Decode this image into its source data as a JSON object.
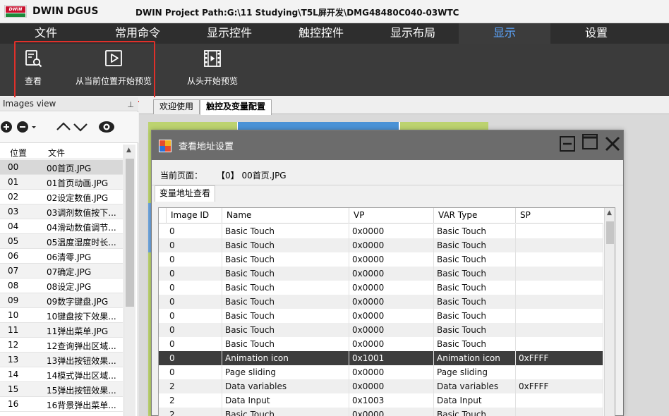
{
  "titlebar": {
    "logo_text": "DWIN",
    "app_name": "DWIN DGUS",
    "project_path": "DWIN Project Path:G:\\11 Studying\\T5L屏开发\\DMG48480C040-03WTC"
  },
  "menu": {
    "items": [
      "文件",
      "常用命令",
      "显示控件",
      "触控控件",
      "显示布局",
      "显示",
      "设置"
    ],
    "active_index": 5,
    "active_color": "#5ca6ff"
  },
  "ribbon": {
    "buttons": [
      {
        "label": "查看",
        "icon": "search-document-icon"
      },
      {
        "label": "从当前位置开始预览",
        "icon": "play-icon"
      },
      {
        "label": "从头开始预览",
        "icon": "film-play-icon"
      }
    ],
    "highlight_color": "#e0302a"
  },
  "images_view": {
    "title": "Images view",
    "toolbar_icons": [
      "add-icon",
      "remove-icon",
      "up-icon",
      "down-icon",
      "eye-icon"
    ],
    "columns": [
      "位置",
      "文件"
    ],
    "rows": [
      {
        "idx": "00",
        "file": "00首页.JPG"
      },
      {
        "idx": "01",
        "file": "01首页动画.JPG"
      },
      {
        "idx": "02",
        "file": "02设定数值.JPG"
      },
      {
        "idx": "03",
        "file": "03调剂数值按下..."
      },
      {
        "idx": "04",
        "file": "04滑动数值调节..."
      },
      {
        "idx": "05",
        "file": "05温度湿度时长..."
      },
      {
        "idx": "06",
        "file": "06清零.JPG"
      },
      {
        "idx": "07",
        "file": "07确定.JPG"
      },
      {
        "idx": "08",
        "file": "08设定.JPG"
      },
      {
        "idx": "09",
        "file": "09数字键盘.JPG"
      },
      {
        "idx": "10",
        "file": "10键盘按下效果..."
      },
      {
        "idx": "11",
        "file": "11弹出菜单.JPG"
      },
      {
        "idx": "12",
        "file": "12查询弹出区域..."
      },
      {
        "idx": "13",
        "file": "13弹出按钮效果..."
      },
      {
        "idx": "14",
        "file": "14模式弹出区域..."
      },
      {
        "idx": "15",
        "file": "15弹出按钮效果..."
      },
      {
        "idx": "16",
        "file": "16背景弹出菜单..."
      }
    ],
    "selected_index": 0
  },
  "workspace": {
    "tabs": [
      "欢迎使用",
      "触控及变量配置"
    ],
    "active_tab": 1
  },
  "dialog": {
    "title": "查看地址设置",
    "current_page_label": "当前页面：",
    "current_page_value": "【0】 00首页.JPG",
    "tab": "变量地址查看",
    "columns": [
      "Image ID",
      "Name",
      "VP",
      "VAR Type",
      "SP"
    ],
    "rows": [
      [
        "0",
        "Basic Touch",
        "0x0000",
        "Basic Touch",
        ""
      ],
      [
        "0",
        "Basic Touch",
        "0x0000",
        "Basic Touch",
        ""
      ],
      [
        "0",
        "Basic Touch",
        "0x0000",
        "Basic Touch",
        ""
      ],
      [
        "0",
        "Basic Touch",
        "0x0000",
        "Basic Touch",
        ""
      ],
      [
        "0",
        "Basic Touch",
        "0x0000",
        "Basic Touch",
        ""
      ],
      [
        "0",
        "Basic Touch",
        "0x0000",
        "Basic Touch",
        ""
      ],
      [
        "0",
        "Basic Touch",
        "0x0000",
        "Basic Touch",
        ""
      ],
      [
        "0",
        "Basic Touch",
        "0x0000",
        "Basic Touch",
        ""
      ],
      [
        "0",
        "Basic Touch",
        "0x0000",
        "Basic Touch",
        ""
      ],
      [
        "0",
        "Animation icon",
        "0x1001",
        "Animation icon",
        "0xFFFF"
      ],
      [
        "0",
        "Page sliding",
        "0x0000",
        "Page sliding",
        ""
      ],
      [
        "2",
        "Data variables",
        "0x0000",
        "Data variables",
        "0xFFFF"
      ],
      [
        "2",
        "Data Input",
        "0x1003",
        "Data Input",
        ""
      ],
      [
        "2",
        "Basic Touch",
        "0x0000",
        "Basic Touch",
        ""
      ]
    ],
    "selected_row": 9
  }
}
